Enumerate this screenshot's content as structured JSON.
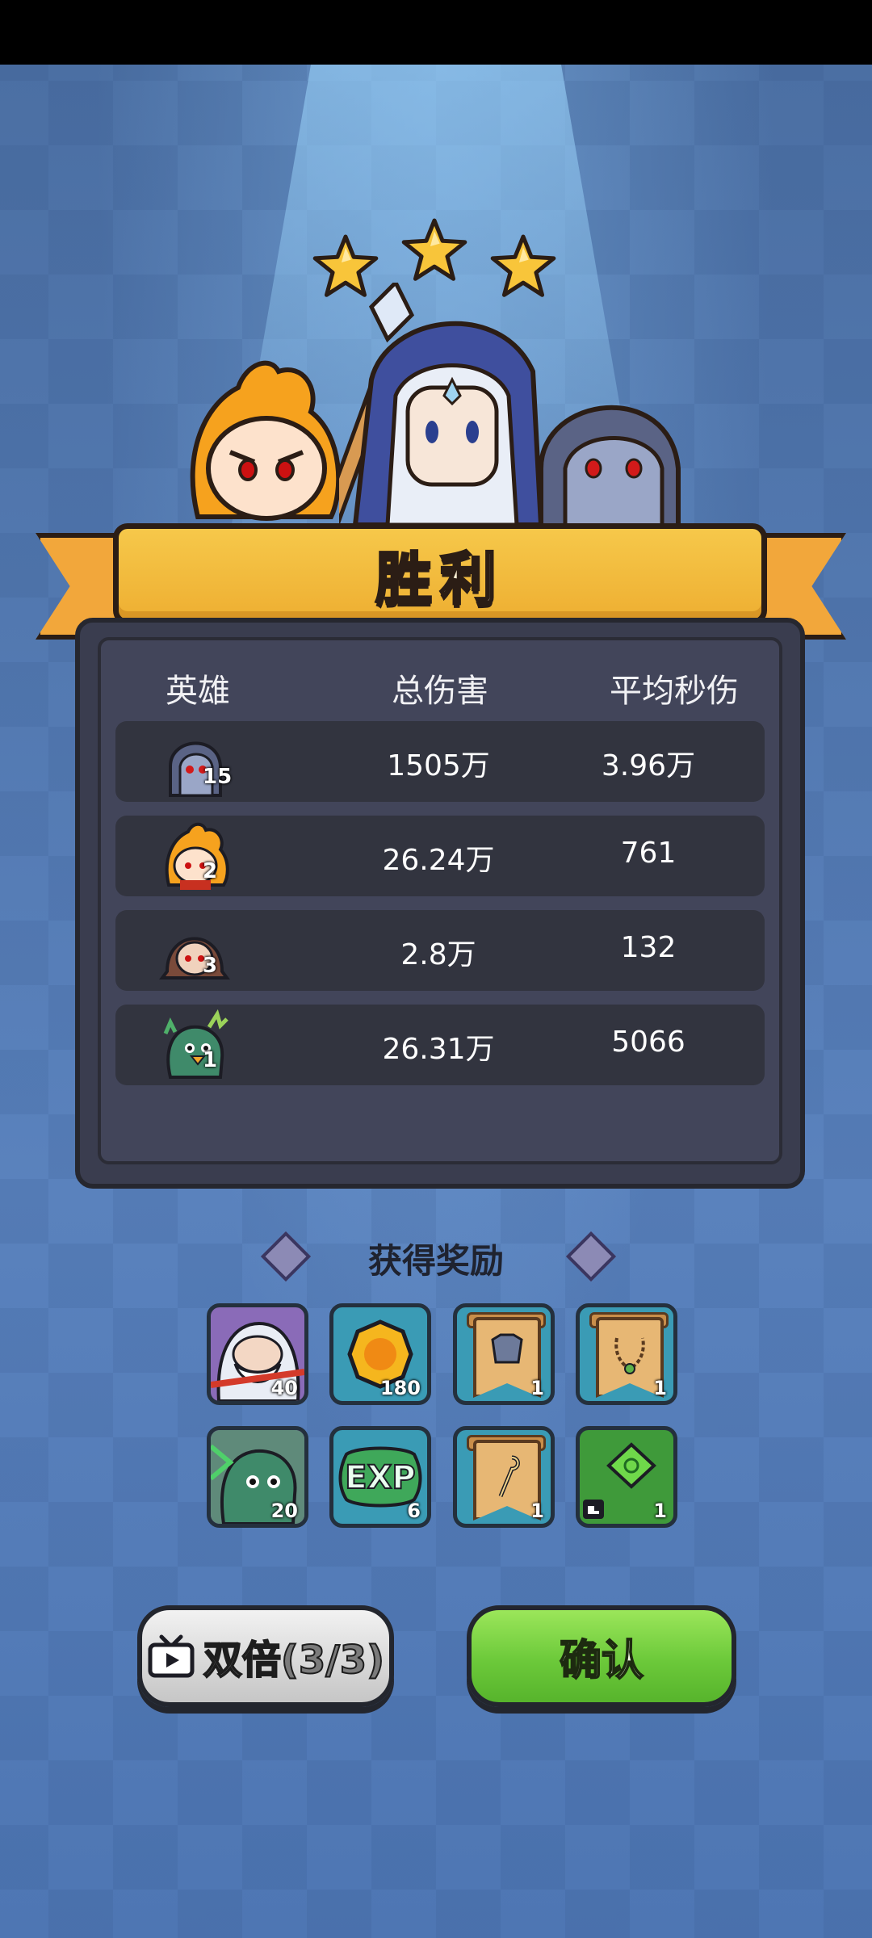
{
  "result": {
    "title": "胜利",
    "stars_earned": 3,
    "stars_total": 3
  },
  "stats": {
    "headers": {
      "hero": "英雄",
      "total_damage": "总伤害",
      "avg_dps": "平均秒伤"
    },
    "rows": [
      {
        "hero_icon": "dark-elf-archer-icon",
        "level": "15",
        "total_damage": "1505万",
        "avg_dps": "3.96万"
      },
      {
        "hero_icon": "fire-monkey-icon",
        "level": "2",
        "total_damage": "26.24万",
        "avg_dps": "761"
      },
      {
        "hero_icon": "hooded-rogue-icon",
        "level": "3",
        "total_damage": "2.8万",
        "avg_dps": "132"
      },
      {
        "hero_icon": "green-dragon-icon",
        "level": "1",
        "total_damage": "26.31万",
        "avg_dps": "5066"
      }
    ]
  },
  "rewards": {
    "title": "获得奖励",
    "items": [
      {
        "icon": "white-beard-sage-shard-icon",
        "count": "40"
      },
      {
        "icon": "gold-coin-icon",
        "count": "180"
      },
      {
        "icon": "armor-scroll-icon",
        "count": "1"
      },
      {
        "icon": "necklace-scroll-icon",
        "count": "1"
      },
      {
        "icon": "green-dragon-shard-icon",
        "count": "20"
      },
      {
        "icon": "exp-icon",
        "count": "6",
        "text": "EXP"
      },
      {
        "icon": "staff-scroll-icon",
        "count": "1"
      },
      {
        "icon": "green-gem-icon",
        "count": "1"
      }
    ]
  },
  "buttons": {
    "double_label": "双倍(3/3)",
    "confirm_label": "确认"
  },
  "colors": {
    "banner": "#eeaf32",
    "panel": "#3a3d4f",
    "confirm": "#6cc93a",
    "background": "#4f74a9"
  }
}
